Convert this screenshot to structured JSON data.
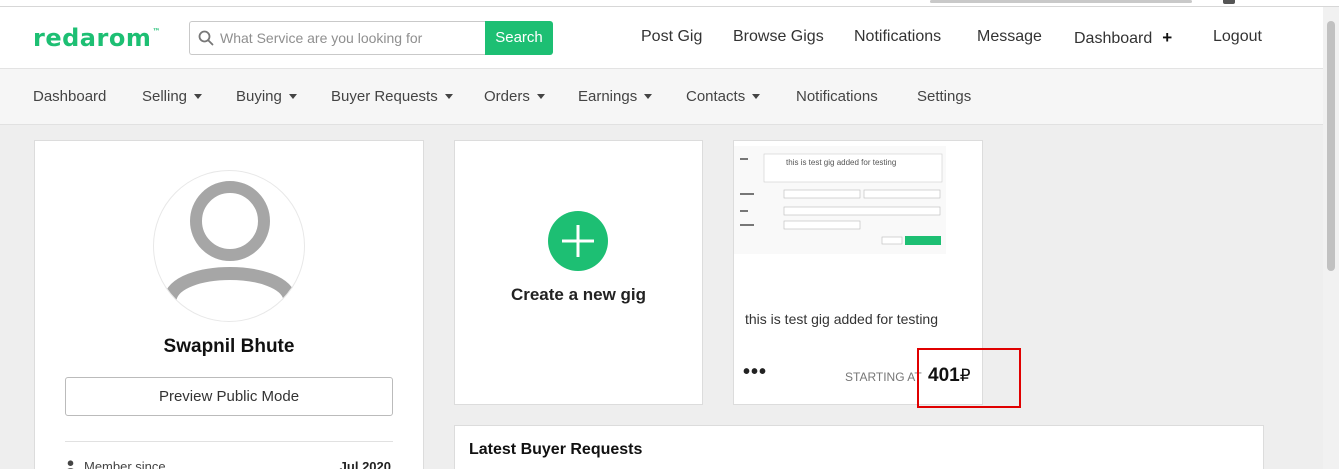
{
  "header": {
    "logo_text": "redarom",
    "logo_mark": "™",
    "search": {
      "placeholder": "What Service are you looking for",
      "button_label": "Search"
    },
    "nav": {
      "post_gig": "Post Gig",
      "browse_gigs": "Browse Gigs",
      "notifications": "Notifications",
      "message": "Message",
      "dashboard": "Dashboard",
      "dashboard_plus": "+",
      "logout": "Logout"
    }
  },
  "subnav": {
    "dashboard": "Dashboard",
    "selling": "Selling",
    "buying": "Buying",
    "buyer_requests": "Buyer Requests",
    "orders": "Orders",
    "earnings": "Earnings",
    "contacts": "Contacts",
    "notifications": "Notifications",
    "settings": "Settings"
  },
  "profile": {
    "name": "Swapnil Bhute",
    "preview_button": "Preview Public Mode",
    "member_since_label": "Member since",
    "member_since_value": "Jul 2020"
  },
  "create_gig": {
    "label": "Create a new gig"
  },
  "gig": {
    "title": "this is test gig added for testing",
    "more": "•••",
    "starting_at_label": "STARTING AT",
    "price": "401",
    "currency": "₽",
    "thumb_text": "this is test gig added for testing"
  },
  "buyer_requests": {
    "title": "Latest Buyer Requests"
  },
  "colors": {
    "brand": "#1dbf73",
    "highlight": "#e00000"
  }
}
